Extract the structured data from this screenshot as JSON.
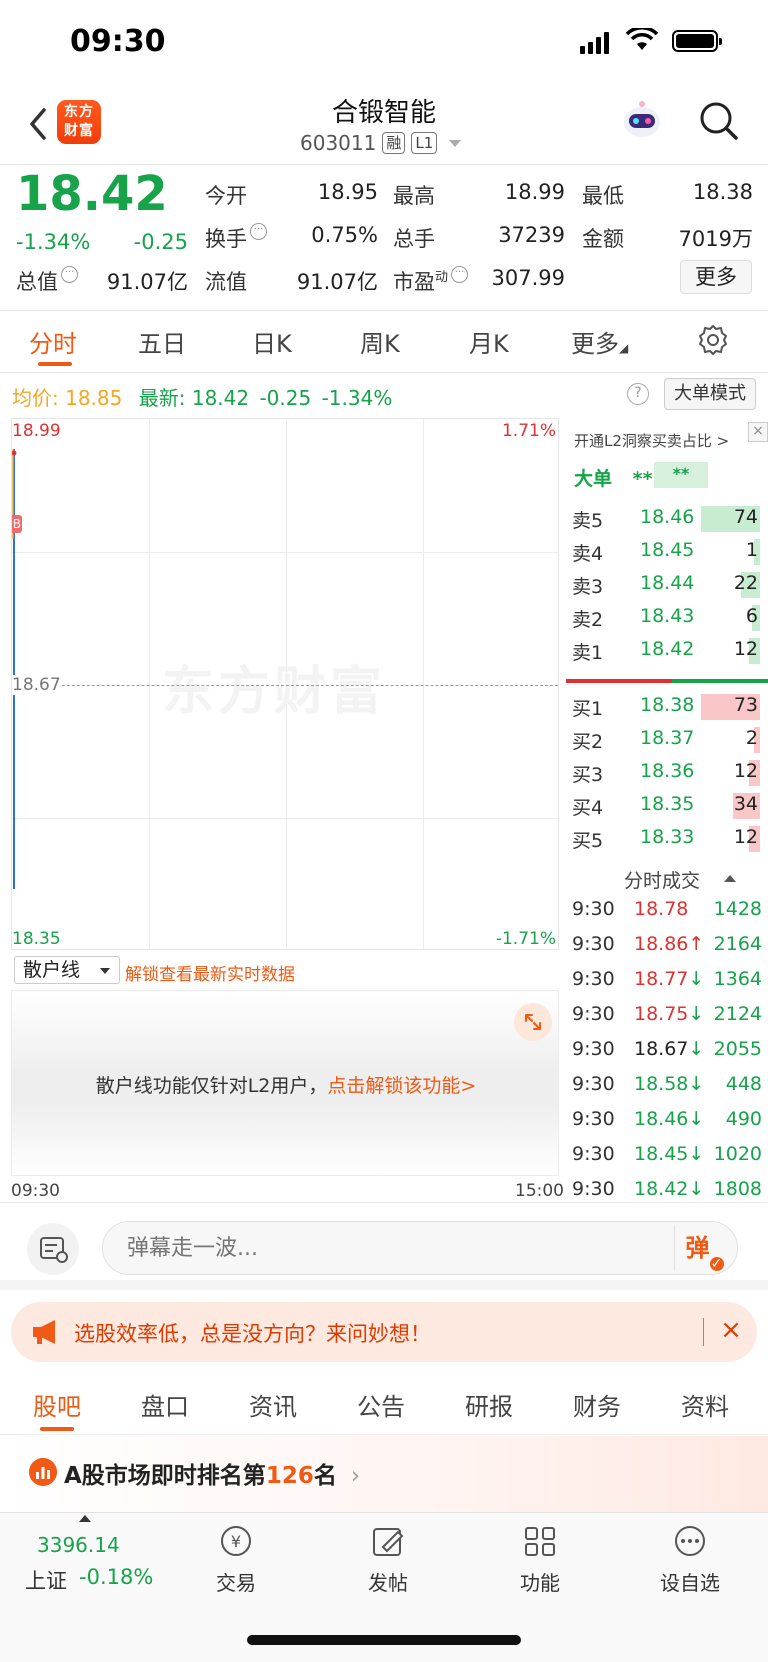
{
  "status": {
    "time": "09:30"
  },
  "header": {
    "title": "合锻智能",
    "code": "603011",
    "tag_margin": "融",
    "tag_level": "L1",
    "logo_text_1": "东方",
    "logo_text_2": "财富"
  },
  "quote": {
    "price": "18.42",
    "change_pct": "-1.34%",
    "change_amt": "-0.25",
    "fields": {
      "open_label": "今开",
      "open": "18.95",
      "high_label": "最高",
      "high": "18.99",
      "low_label": "最低",
      "low": "18.38",
      "turnover_label": "换手",
      "turnover": "0.75%",
      "volume_label": "总手",
      "volume": "37239",
      "amount_label": "金额",
      "amount": "7019万",
      "mktcap_label": "总值",
      "mktcap": "91.07亿",
      "float_label": "流值",
      "float": "91.07亿",
      "pe_label": "市盈",
      "pe_sup": "动",
      "pe": "307.99"
    },
    "more_label": "更多"
  },
  "chart_tabs": [
    "分时",
    "五日",
    "日K",
    "周K",
    "月K",
    "更多"
  ],
  "avg_row": {
    "avg_label": "均价:",
    "avg_value": "18.85",
    "latest_label": "最新:",
    "latest_value": "18.42",
    "latest_change": "-0.25",
    "latest_pct": "-1.34%",
    "help": "?",
    "mode_label": "大单模式"
  },
  "chart": {
    "y_top": "18.99",
    "y_mid": "18.67",
    "y_bottom": "18.35",
    "pct_top": "1.71%",
    "pct_bottom": "-1.71%",
    "watermark": "东方财富",
    "time_start": "09:30",
    "time_end": "15:00",
    "marker": "B"
  },
  "sanhu": {
    "select_label": "散户线",
    "unlock_link": "解锁查看最新实时数据",
    "msg_prefix": "散户线功能仅针对L2用户，",
    "msg_link": "点击解锁该功能>"
  },
  "orderbook": {
    "top_link": "开通L2洞察买卖占比 >",
    "big_label": "大单",
    "big_val1": "**",
    "big_val2": "**",
    "asks": [
      {
        "label": "卖5",
        "price": "18.46",
        "vol": "74",
        "ratio": 0.78
      },
      {
        "label": "卖4",
        "price": "18.45",
        "vol": "1",
        "ratio": 0.08
      },
      {
        "label": "卖3",
        "price": "18.44",
        "vol": "22",
        "ratio": 0.25
      },
      {
        "label": "卖2",
        "price": "18.43",
        "vol": "6",
        "ratio": 0.1
      },
      {
        "label": "卖1",
        "price": "18.42",
        "vol": "12",
        "ratio": 0.14
      }
    ],
    "bids": [
      {
        "label": "买1",
        "price": "18.38",
        "vol": "73",
        "ratio": 0.78
      },
      {
        "label": "买2",
        "price": "18.37",
        "vol": "2",
        "ratio": 0.08
      },
      {
        "label": "买3",
        "price": "18.36",
        "vol": "12",
        "ratio": 0.14
      },
      {
        "label": "买4",
        "price": "18.35",
        "vol": "34",
        "ratio": 0.36
      },
      {
        "label": "买5",
        "price": "18.33",
        "vol": "12",
        "ratio": 0.14
      }
    ],
    "ticks_title": "分时成交",
    "ticks": [
      {
        "time": "9:30",
        "price": "18.78",
        "arrow": "",
        "vol": "1428",
        "dir": "up"
      },
      {
        "time": "9:30",
        "price": "18.86",
        "arrow": "↑",
        "vol": "2164",
        "dir": "up"
      },
      {
        "time": "9:30",
        "price": "18.77",
        "arrow": "↓",
        "vol": "1364",
        "dir": "up"
      },
      {
        "time": "9:30",
        "price": "18.75",
        "arrow": "↓",
        "vol": "2124",
        "dir": "up"
      },
      {
        "time": "9:30",
        "price": "18.67",
        "arrow": "↓",
        "vol": "2055",
        "dir": "flat"
      },
      {
        "time": "9:30",
        "price": "18.58",
        "arrow": "↓",
        "vol": "448",
        "dir": "down"
      },
      {
        "time": "9:30",
        "price": "18.46",
        "arrow": "↓",
        "vol": "490",
        "dir": "down"
      },
      {
        "time": "9:30",
        "price": "18.45",
        "arrow": "↓",
        "vol": "1020",
        "dir": "down"
      },
      {
        "time": "9:30",
        "price": "18.42",
        "arrow": "↓",
        "vol": "1808",
        "dir": "down"
      }
    ]
  },
  "comment": {
    "placeholder": "弹幕走一波...",
    "danmu_btn": "弹"
  },
  "promo": {
    "text": "选股效率低，总是没方向？来问妙想！",
    "close": "×"
  },
  "bottom_tabs": [
    "股吧",
    "盘口",
    "资讯",
    "公告",
    "研报",
    "财务",
    "资料"
  ],
  "rank": {
    "prefix": "A股市场即时排名第",
    "num": "126",
    "suffix": "名",
    "chevron": "›"
  },
  "bottombar": {
    "index_value": "3396.14",
    "index_name": "上证",
    "index_pct": "-0.18%",
    "items": [
      "交易",
      "发帖",
      "功能",
      "设自选"
    ]
  },
  "colors": {
    "up": "#e03131",
    "down": "#16a34a",
    "accent": "#f05a14"
  }
}
